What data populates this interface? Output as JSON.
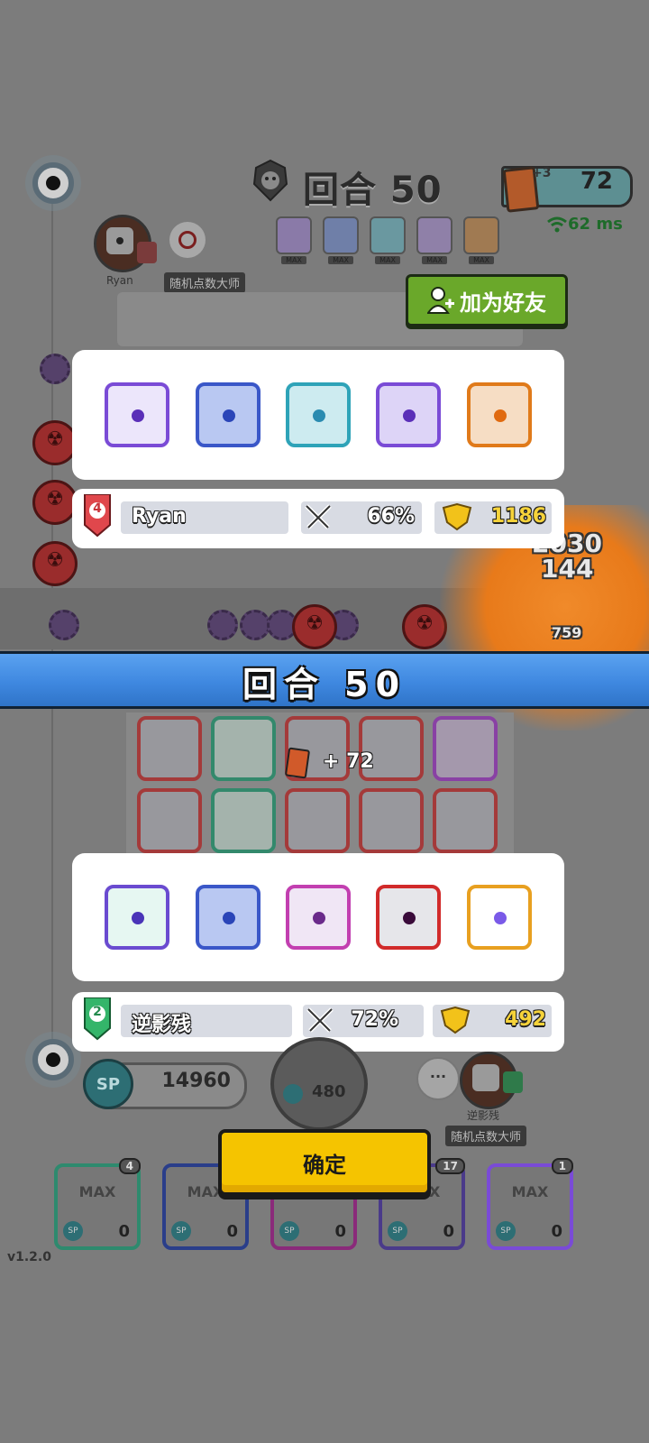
{
  "hud": {
    "round_label": "回合 50",
    "gold": "72",
    "card_bonus": "+3",
    "ping": "62 ms",
    "opponent": {
      "name": "Ryan",
      "rank": "4",
      "title": "随机点数大师"
    },
    "mini_deck_labels": [
      "MAX",
      "MAX",
      "MAX",
      "MAX",
      "MAX"
    ]
  },
  "add_friend": {
    "label": "加为好友"
  },
  "top_player": {
    "dice": [
      {
        "icon": "purple-dragon-die-icon",
        "border": "#7a4bd6",
        "fill": "#ece6fb",
        "pip": "#5a2fb8"
      },
      {
        "icon": "blue-gear-die-icon",
        "border": "#3a57c8",
        "fill": "#b9c8f2",
        "pip": "#2a45b8"
      },
      {
        "icon": "teal-vortex-die-icon",
        "border": "#2ea3b8",
        "fill": "#cdebf0",
        "pip": "#2a8bb0"
      },
      {
        "icon": "violet-web-die-icon",
        "border": "#7a4bd6",
        "fill": "#ddd4f7",
        "pip": "#5a2fb8"
      },
      {
        "icon": "orange-sun-die-icon",
        "border": "#e07a1a",
        "fill": "#f6ddc4",
        "pip": "#e06a10"
      }
    ],
    "rank": "4",
    "name": "Ryan",
    "win_rate": "66%",
    "trophies": "1186"
  },
  "round_banner": {
    "label": "回合 50"
  },
  "reward": {
    "text": "+ 72"
  },
  "bottom_player": {
    "dice": [
      {
        "icon": "teal-hands-die-icon",
        "border": "#6a4bd0",
        "fill": "#e6f7f2",
        "pip": "#4a35b8"
      },
      {
        "icon": "blue-gear-die-icon",
        "border": "#3a57c8",
        "fill": "#b9c8f2",
        "pip": "#2a45b8"
      },
      {
        "icon": "magenta-sword-die-icon",
        "border": "#c23fb0",
        "fill": "#f0e6f5",
        "pip": "#6a2a8a"
      },
      {
        "icon": "red-blade-die-icon",
        "border": "#d12a2a",
        "fill": "#e6e6ea",
        "pip": "#3a0b3a"
      },
      {
        "icon": "rainbow-die-icon",
        "border": "#e8a020",
        "fill": "#ffffff",
        "pip": "#7a5ae8"
      }
    ],
    "rank": "2",
    "name": "逆影残",
    "win_rate": "72%",
    "trophies": "492",
    "title": "随机点数大师"
  },
  "bottom_hud": {
    "sp_label": "SP",
    "sp_value": "14960",
    "summon_cost": "480",
    "chat_label": "···"
  },
  "confirm": {
    "label": "确定"
  },
  "deck": [
    {
      "label": "MAX",
      "count": "0",
      "level": "4",
      "border": "#2e8a6e"
    },
    {
      "label": "MAX",
      "count": "0",
      "level": "",
      "border": "#2a3e8a"
    },
    {
      "label": "",
      "count": "0",
      "level": "",
      "border": "#8a2a7a"
    },
    {
      "label": "MAX",
      "count": "0",
      "level": "17",
      "border": "#4a3a8a"
    },
    {
      "label": "MAX",
      "count": "0",
      "level": "1",
      "border": "#7a4bd6"
    }
  ],
  "version": "v1.2.0",
  "floating_numbers": [
    "2030",
    "144",
    "759"
  ]
}
